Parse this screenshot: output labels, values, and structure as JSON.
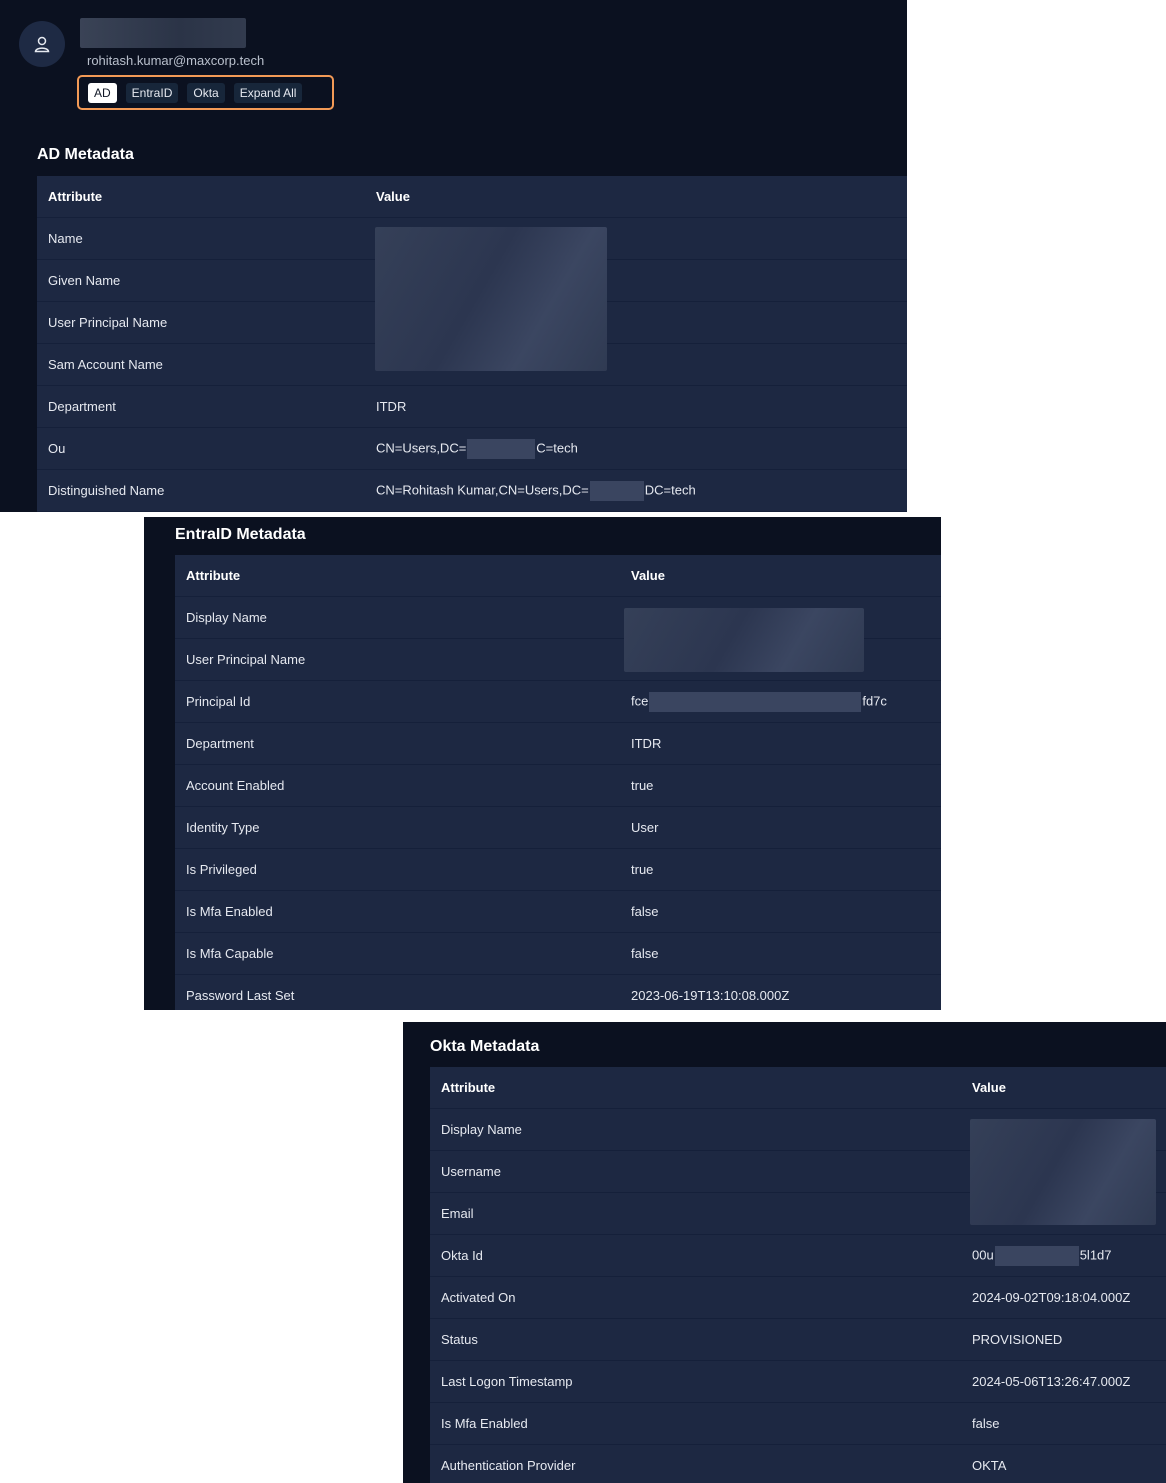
{
  "profile": {
    "email": "rohitash.kumar@maxcorp.tech",
    "filters": [
      "AD",
      "EntraID",
      "Okta",
      "Expand All"
    ],
    "active_filter": "AD"
  },
  "colors": {
    "panel_bg": "#0b1120",
    "table_bg": "#1d2842",
    "highlight_border": "#f39a56"
  },
  "ad": {
    "title": "AD Metadata",
    "header": {
      "attribute": "Attribute",
      "value": "Value"
    },
    "rows": [
      {
        "attr": "Name",
        "value": ""
      },
      {
        "attr": "Given Name",
        "value": ""
      },
      {
        "attr": "User Principal Name",
        "value": ""
      },
      {
        "attr": "Sam Account Name",
        "value": ""
      },
      {
        "attr": "Department",
        "value": "ITDR"
      },
      {
        "attr": "Ou",
        "value_prefix": "CN=Users,DC=",
        "value_suffix": "C=tech"
      },
      {
        "attr": "Distinguished Name",
        "value_prefix": "CN=Rohitash Kumar,CN=Users,DC=",
        "value_suffix": "DC=tech"
      }
    ]
  },
  "entra": {
    "title": "EntraID Metadata",
    "header": {
      "attribute": "Attribute",
      "value": "Value"
    },
    "rows": [
      {
        "attr": "Display Name",
        "value": ""
      },
      {
        "attr": "User Principal Name",
        "value": ""
      },
      {
        "attr": "Principal Id",
        "value_prefix": "fce",
        "value_suffix": "fd7c"
      },
      {
        "attr": "Department",
        "value": "ITDR"
      },
      {
        "attr": "Account Enabled",
        "value": "true"
      },
      {
        "attr": "Identity Type",
        "value": "User"
      },
      {
        "attr": "Is Privileged",
        "value": "true"
      },
      {
        "attr": "Is Mfa Enabled",
        "value": "false"
      },
      {
        "attr": "Is Mfa Capable",
        "value": "false"
      },
      {
        "attr": "Password Last Set",
        "value": "2023-06-19T13:10:08.000Z"
      }
    ]
  },
  "okta": {
    "title": "Okta Metadata",
    "header": {
      "attribute": "Attribute",
      "value": "Value"
    },
    "rows": [
      {
        "attr": "Display Name",
        "value": ""
      },
      {
        "attr": "Username",
        "value": ""
      },
      {
        "attr": "Email",
        "value": ""
      },
      {
        "attr": "Okta Id",
        "value_prefix": "00u",
        "value_suffix": "5l1d7"
      },
      {
        "attr": "Activated On",
        "value": "2024-09-02T09:18:04.000Z"
      },
      {
        "attr": "Status",
        "value": "PROVISIONED"
      },
      {
        "attr": "Last Logon Timestamp",
        "value": "2024-05-06T13:26:47.000Z"
      },
      {
        "attr": "Is Mfa Enabled",
        "value": "false"
      },
      {
        "attr": "Authentication Provider",
        "value": "OKTA"
      }
    ]
  }
}
